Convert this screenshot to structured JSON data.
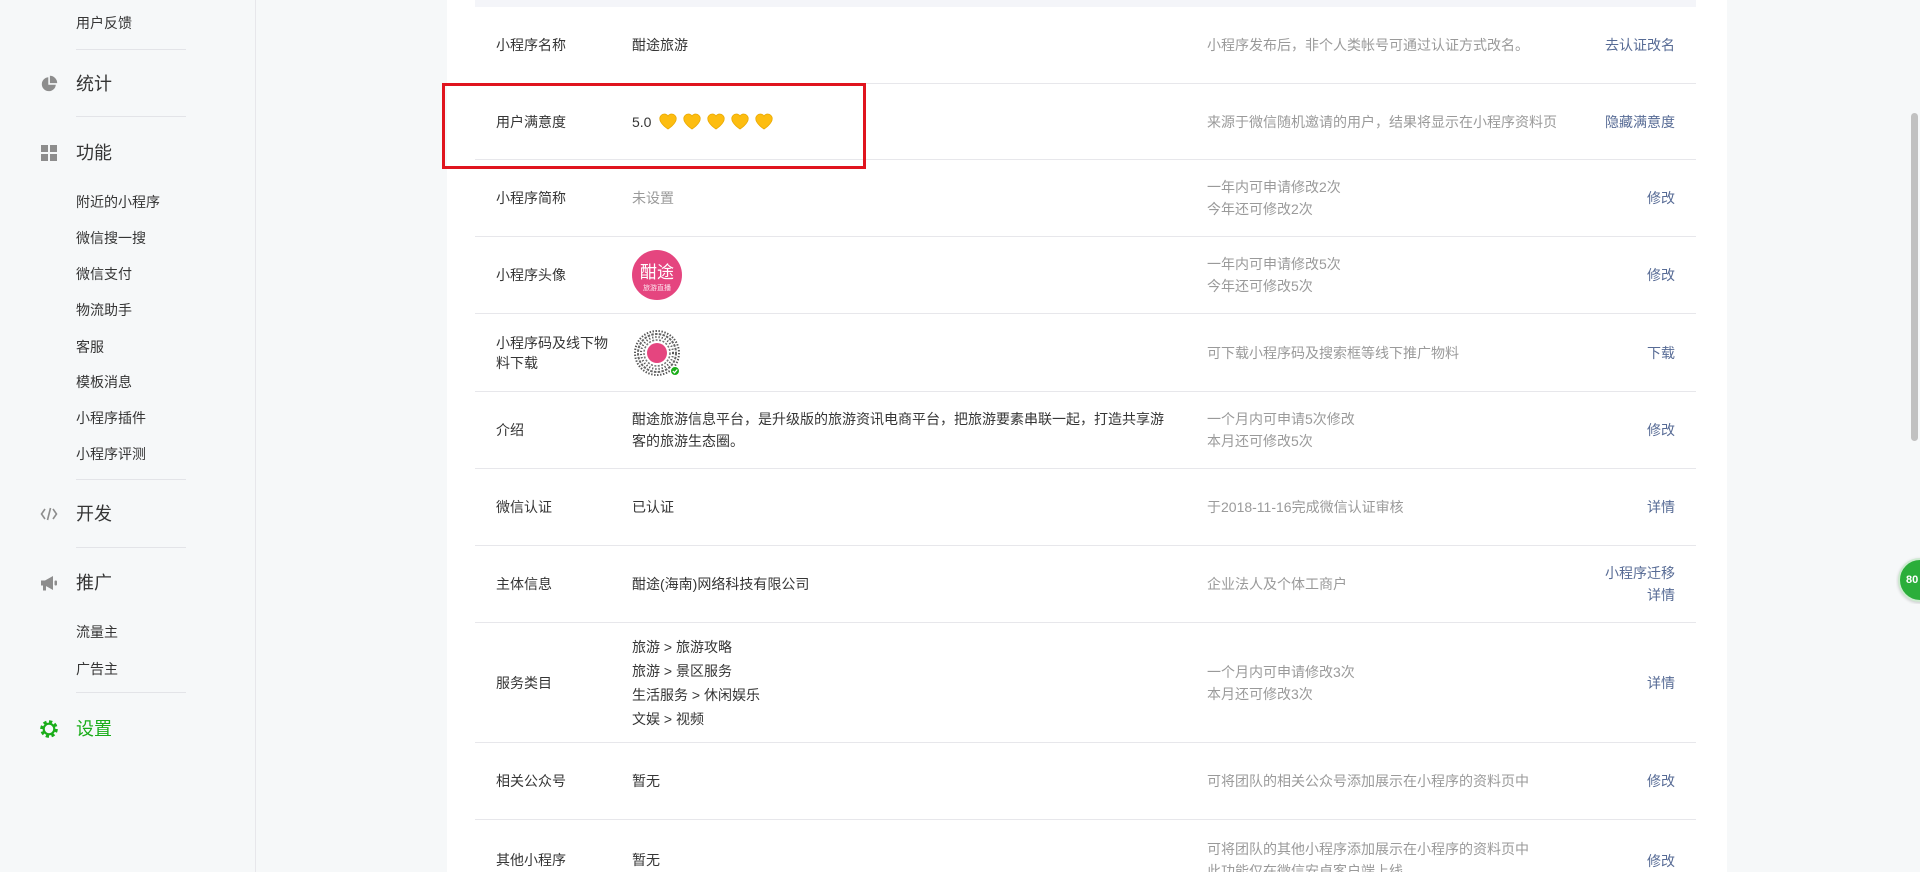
{
  "colors": {
    "accent": "#1aad19",
    "link": "#576b95",
    "highlight": "#e0141e",
    "heart": "#fdbd10",
    "avatar": "#e5457f"
  },
  "sidebar": {
    "feedback": "用户反馈",
    "stats": {
      "label": "统计",
      "icon": "pie-chart-icon"
    },
    "features": {
      "label": "功能",
      "icon": "grid-icon",
      "items": [
        "附近的小程序",
        "微信搜一搜",
        "微信支付",
        "物流助手",
        "客服",
        "模板消息",
        "小程序插件",
        "小程序评测"
      ]
    },
    "dev": {
      "label": "开发",
      "icon": "code-icon"
    },
    "promotion": {
      "label": "推广",
      "icon": "megaphone-icon",
      "items": [
        "流量主",
        "广告主"
      ]
    },
    "settings": {
      "label": "设置",
      "icon": "gear-icon",
      "active": true
    }
  },
  "rows": {
    "name": {
      "label": "小程序名称",
      "value": "酣途旅游",
      "desc": [
        "小程序发布后，非个人类帐号可通过认证方式改名。"
      ],
      "action": "去认证改名"
    },
    "satisfaction": {
      "label": "用户满意度",
      "score": "5.0",
      "hearts": 5,
      "icon": "heart-icon",
      "desc": [
        "来源于微信随机邀请的用户，结果将显示在小程序资料页"
      ],
      "action": "隐藏满意度"
    },
    "short_name": {
      "label": "小程序简称",
      "value": "未设置",
      "desc": [
        "一年内可申请修改2次",
        "今年还可修改2次"
      ],
      "action": "修改"
    },
    "avatar": {
      "label": "小程序头像",
      "logo_text": "酣途",
      "logo_subtext": "旅游直播",
      "desc": [
        "一年内可申请修改5次",
        "今年还可修改5次"
      ],
      "action": "修改"
    },
    "qrcode": {
      "label": "小程序码及线下物料下载",
      "icon": "mini-program-code-icon",
      "desc": [
        "可下载小程序码及搜索框等线下推广物料"
      ],
      "action": "下载"
    },
    "intro": {
      "label": "介绍",
      "value": "酣途旅游信息平台，是升级版的旅游资讯电商平台，把旅游要素串联一起，打造共享游客的旅游生态圈。",
      "desc": [
        "一个月内可申请5次修改",
        "本月还可修改5次"
      ],
      "action": "修改"
    },
    "verify": {
      "label": "微信认证",
      "value": "已认证",
      "desc": [
        "于2018-11-16完成微信认证审核"
      ],
      "action": "详情"
    },
    "entity": {
      "label": "主体信息",
      "value": "酣途(海南)网络科技有限公司",
      "desc": [
        "企业法人及个体工商户"
      ],
      "actions": [
        "小程序迁移",
        "详情"
      ]
    },
    "category": {
      "label": "服务类目",
      "values": [
        "旅游 > 旅游攻略",
        "旅游 > 景区服务",
        "生活服务 > 休闲娱乐",
        "文娱 > 视频"
      ],
      "desc": [
        "一个月内可申请修改3次",
        "本月还可修改3次"
      ],
      "action": "详情"
    },
    "official_account": {
      "label": "相关公众号",
      "value": "暂无",
      "desc": [
        "可将团队的相关公众号添加展示在小程序的资料页中"
      ],
      "action": "修改"
    },
    "other_apps": {
      "label": "其他小程序",
      "value": "暂无",
      "desc": [
        "可将团队的其他小程序添加展示在小程序的资料页中",
        "此功能仅在微信安卓客户端上线"
      ],
      "action": "修改"
    }
  },
  "float_badge": {
    "value": "80"
  }
}
